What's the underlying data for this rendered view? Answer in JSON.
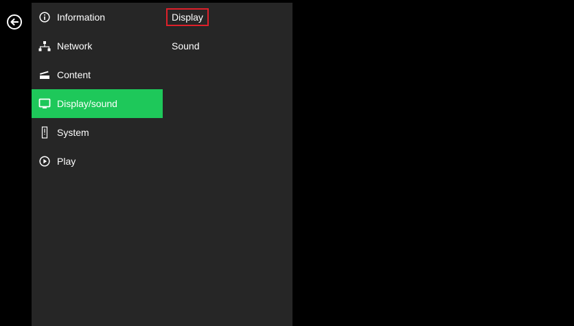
{
  "nav": {
    "back_icon": "back-arrow-circle-icon",
    "items": [
      {
        "label": "Information",
        "icon": "info-circle-icon",
        "active": false
      },
      {
        "label": "Network",
        "icon": "network-icon",
        "active": false
      },
      {
        "label": "Content",
        "icon": "clapperboard-icon",
        "active": false
      },
      {
        "label": "Display/sound",
        "icon": "monitor-icon",
        "active": true
      },
      {
        "label": "System",
        "icon": "system-info-icon",
        "active": false
      },
      {
        "label": "Play",
        "icon": "play-circle-icon",
        "active": false
      }
    ]
  },
  "submenu": {
    "items": [
      {
        "label": "Display",
        "highlighted": true
      },
      {
        "label": "Sound",
        "highlighted": false
      }
    ]
  },
  "colors": {
    "background": "#000000",
    "panel": "#262626",
    "active": "#1ec85a",
    "highlight_border": "#e0202a",
    "text": "#ffffff"
  }
}
